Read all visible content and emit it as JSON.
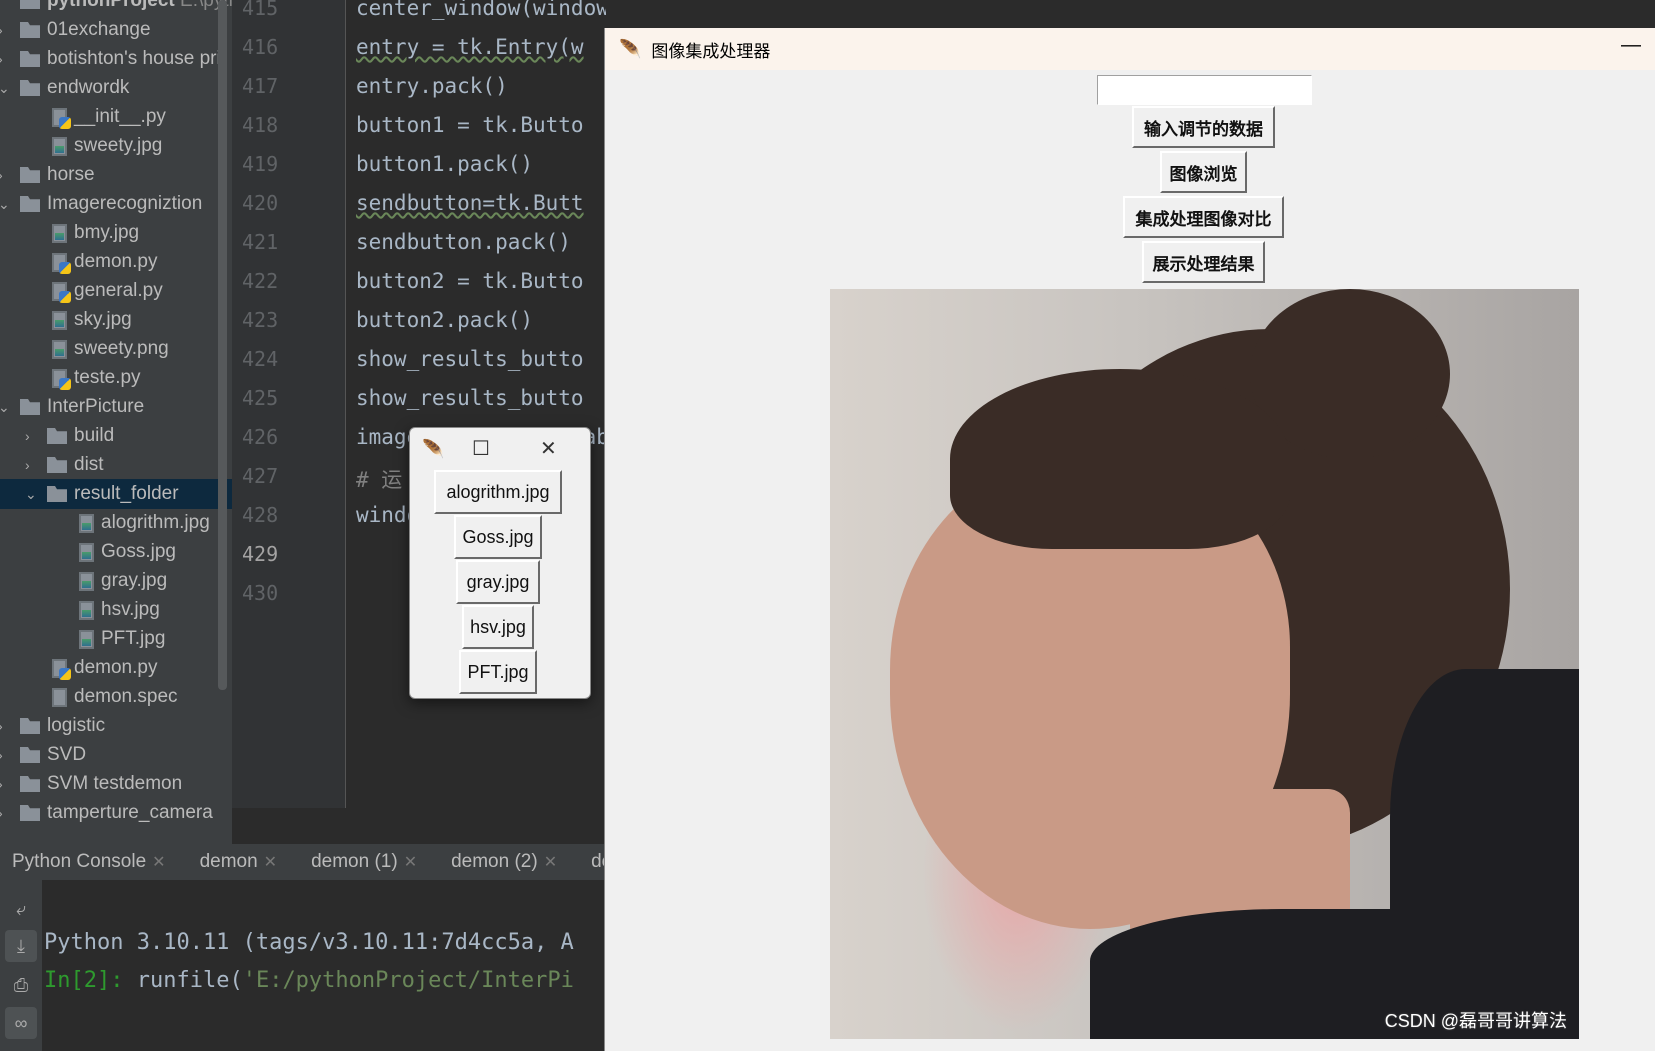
{
  "project": {
    "title": "pythonProject",
    "path": "E:\\pytho"
  },
  "tree": [
    {
      "label": "01exchange",
      "type": "folder",
      "depth": 0,
      "arrow": "›"
    },
    {
      "label": "botishton's house pri",
      "type": "folder",
      "depth": 0,
      "arrow": "›"
    },
    {
      "label": "endwordk",
      "type": "folder",
      "depth": 0,
      "arrow": "⌄"
    },
    {
      "label": "__init__.py",
      "type": "py",
      "depth": 1
    },
    {
      "label": "sweety.jpg",
      "type": "img",
      "depth": 1
    },
    {
      "label": "horse",
      "type": "folder",
      "depth": 0,
      "arrow": "›"
    },
    {
      "label": "Imagerecogniztion",
      "type": "folder",
      "depth": 0,
      "arrow": "⌄"
    },
    {
      "label": "bmy.jpg",
      "type": "img",
      "depth": 1
    },
    {
      "label": "demon.py",
      "type": "py",
      "depth": 1
    },
    {
      "label": "general.py",
      "type": "py",
      "depth": 1
    },
    {
      "label": "sky.jpg",
      "type": "img",
      "depth": 1
    },
    {
      "label": "sweety.png",
      "type": "img",
      "depth": 1
    },
    {
      "label": "teste.py",
      "type": "py",
      "depth": 1
    },
    {
      "label": "InterPicture",
      "type": "folder",
      "depth": 0,
      "arrow": "⌄"
    },
    {
      "label": "build",
      "type": "folder",
      "depth": 1,
      "arrow": "›"
    },
    {
      "label": "dist",
      "type": "folder",
      "depth": 1,
      "arrow": "›"
    },
    {
      "label": "result_folder",
      "type": "folder",
      "depth": 1,
      "arrow": "⌄",
      "selected": true
    },
    {
      "label": "alogrithm.jpg",
      "type": "img",
      "depth": 2
    },
    {
      "label": "Goss.jpg",
      "type": "img",
      "depth": 2
    },
    {
      "label": "gray.jpg",
      "type": "img",
      "depth": 2
    },
    {
      "label": "hsv.jpg",
      "type": "img",
      "depth": 2
    },
    {
      "label": "PFT.jpg",
      "type": "img",
      "depth": 2
    },
    {
      "label": "demon.py",
      "type": "py",
      "depth": 1
    },
    {
      "label": "demon.spec",
      "type": "file",
      "depth": 1
    },
    {
      "label": "logistic",
      "type": "folder",
      "depth": 0,
      "arrow": "›"
    },
    {
      "label": "SVD",
      "type": "folder",
      "depth": 0,
      "arrow": "›"
    },
    {
      "label": "SVM testdemon",
      "type": "folder",
      "depth": 0,
      "arrow": "›"
    },
    {
      "label": "tamperture_camera",
      "type": "folder",
      "depth": 0,
      "arrow": "›"
    }
  ],
  "code": [
    {
      "n": "415",
      "text": "center_window(window)"
    },
    {
      "n": "416",
      "text": "entry = tk.Entry(w",
      "warn": true
    },
    {
      "n": "417",
      "text": "entry.pack()"
    },
    {
      "n": "418",
      "text": "button1 = tk.Butto"
    },
    {
      "n": "419",
      "text": "button1.pack()"
    },
    {
      "n": "420",
      "text": "sendbutton=tk.Butt",
      "warn": true
    },
    {
      "n": "421",
      "text": "sendbutton.pack()"
    },
    {
      "n": "422",
      "text": "button2 = tk.Butto"
    },
    {
      "n": "423",
      "text": "button2.pack()"
    },
    {
      "n": "424",
      "text": "show_results_butto"
    },
    {
      "n": "425",
      "text": "show_results_butto"
    },
    {
      "n": "426",
      "text": "image_label = tk.Lab"
    },
    {
      "n": "427",
      "text": "# 运",
      "comment": true
    },
    {
      "n": "428",
      "text": "window.mainloop()"
    },
    {
      "n": "429",
      "text": ""
    },
    {
      "n": "430",
      "text": ""
    }
  ],
  "console_tabs": [
    "Python Console",
    "demon",
    "demon (1)",
    "demon (2)",
    "de"
  ],
  "console": {
    "line1": "Python 3.10.11 (tags/v3.10.11:7d4cc5a, A",
    "prompt": "In[2]:",
    "cmd": " runfile(",
    "str": "'E:/pythonProject/InterPi"
  },
  "tk": {
    "title": "图像集成处理器",
    "minimize": "—",
    "entry_value": "",
    "buttons": [
      "输入调节的数据",
      "图像浏览",
      "集成处理图像对比",
      "展示处理结果"
    ],
    "watermark": "CSDN @磊哥哥讲算法"
  },
  "popup": {
    "buttons": [
      "alogrithm.jpg",
      "Goss.jpg",
      "gray.jpg",
      "hsv.jpg",
      "PFT.jpg"
    ],
    "maximize": "☐",
    "close": "✕"
  }
}
